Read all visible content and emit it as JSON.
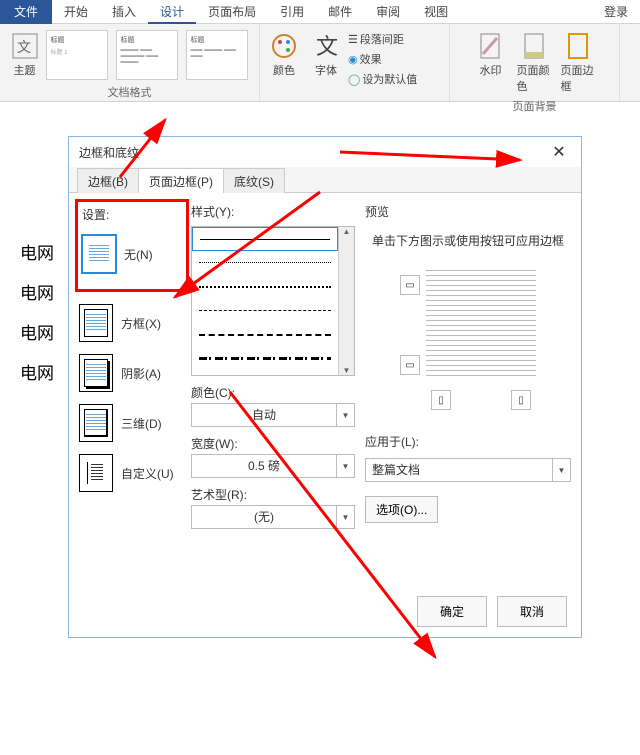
{
  "tabs": {
    "file": "文件",
    "home": "开始",
    "insert": "插入",
    "design": "设计",
    "layout": "页面布局",
    "references": "引用",
    "mail": "邮件",
    "review": "审阅",
    "view": "视图",
    "login": "登录"
  },
  "ribbon": {
    "themes": "主题",
    "title_label": "标题",
    "titles_label": "标题 1",
    "doc_format_group": "文档格式",
    "colors": "颜色",
    "fonts": "字体",
    "para_spacing": "段落间距",
    "effects": "效果",
    "set_default": "设为默认值",
    "watermark": "水印",
    "page_color": "页面颜色",
    "page_border": "页面边框",
    "page_bg_group": "页面背景"
  },
  "dialog": {
    "title": "边框和底纹",
    "tabs": {
      "border": "边框(B)",
      "page_border": "页面边框(P)",
      "shading": "底纹(S)"
    },
    "settings": "设置:",
    "presets": {
      "none": "无(N)",
      "box": "方框(X)",
      "shadow": "阴影(A)",
      "threeD": "三维(D)",
      "custom": "自定义(U)"
    },
    "style": "样式(Y):",
    "color": "颜色(C):",
    "color_auto": "自动",
    "width": "宽度(W):",
    "width_val": "0.5 磅",
    "art": "艺术型(R):",
    "art_none": "(无)",
    "preview": "预览",
    "preview_hint": "单击下方图示或使用按钮可应用边框",
    "apply_to": "应用于(L):",
    "apply_val": "整篇文档",
    "options": "选项(O)...",
    "ok": "确定",
    "cancel": "取消"
  },
  "body_text": "电网"
}
